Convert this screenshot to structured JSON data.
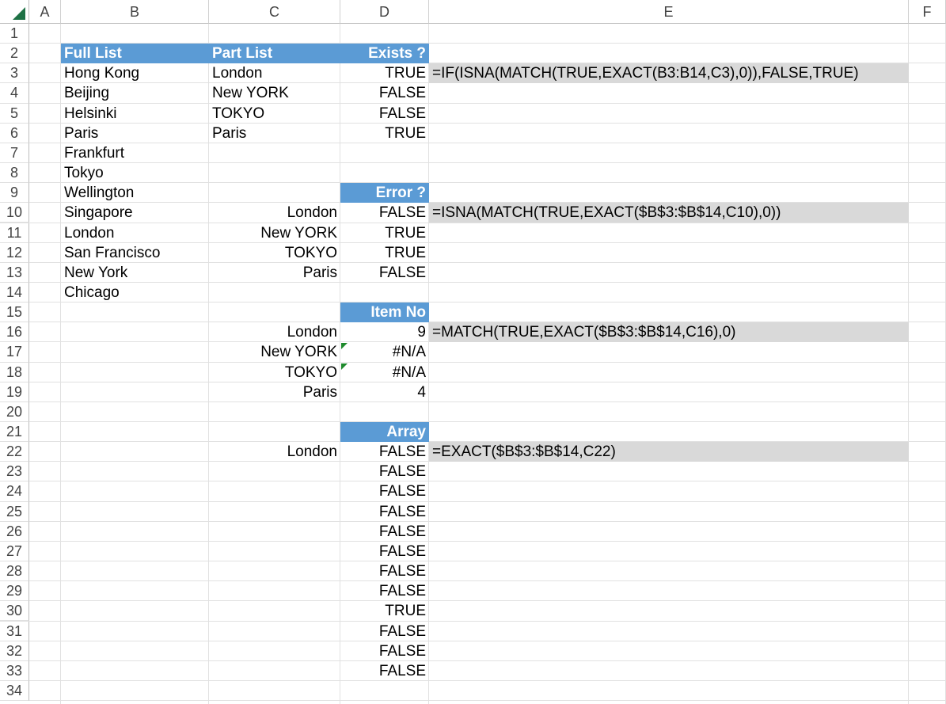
{
  "columns": [
    "A",
    "B",
    "C",
    "D",
    "E",
    "F"
  ],
  "rows": [
    "1",
    "2",
    "3",
    "4",
    "5",
    "6",
    "7",
    "8",
    "9",
    "10",
    "11",
    "12",
    "13",
    "14",
    "15",
    "16",
    "17",
    "18",
    "19",
    "20",
    "21",
    "22",
    "23",
    "24",
    "25",
    "26",
    "27",
    "28",
    "29",
    "30",
    "31",
    "32",
    "33",
    "34"
  ],
  "headers": {
    "full_list": "Full List",
    "part_list": "Part List",
    "exists": "Exists ?",
    "error": "Error ?",
    "item_no": "Item No",
    "array": "Array"
  },
  "full_list": [
    "Hong Kong",
    "Beijing",
    "Helsinki",
    "Paris",
    "Frankfurt",
    "Tokyo",
    "Wellington",
    "Singapore",
    "London",
    "San Francisco",
    "New York",
    "Chicago"
  ],
  "part_list": [
    "London",
    "New YORK",
    "TOKYO",
    "Paris"
  ],
  "exists_results": [
    "TRUE",
    "FALSE",
    "FALSE",
    "TRUE"
  ],
  "exists_formula": "=IF(ISNA(MATCH(TRUE,EXACT(B3:B14,C3),0)),FALSE,TRUE)",
  "error_lookups": [
    "London",
    "New YORK",
    "TOKYO",
    "Paris"
  ],
  "error_results": [
    "FALSE",
    "TRUE",
    "TRUE",
    "FALSE"
  ],
  "error_formula": "=ISNA(MATCH(TRUE,EXACT($B$3:$B$14,C10),0))",
  "item_lookups": [
    "London",
    "New YORK",
    "TOKYO",
    "Paris"
  ],
  "item_results": [
    "9",
    "#N/A",
    "#N/A",
    "4"
  ],
  "item_formula": "=MATCH(TRUE,EXACT($B$3:$B$14,C16),0)",
  "array_lookup": "London",
  "array_results": [
    "FALSE",
    "FALSE",
    "FALSE",
    "FALSE",
    "FALSE",
    "FALSE",
    "FALSE",
    "FALSE",
    "TRUE",
    "FALSE",
    "FALSE",
    "FALSE"
  ],
  "array_formula": "=EXACT($B$3:$B$14,C22)",
  "colors": {
    "header_fill": "#5b9bd5",
    "formula_fill": "#d9d9d9",
    "error_indicator": "#1e8a2c",
    "select_all_triangle": "#1e7145"
  }
}
